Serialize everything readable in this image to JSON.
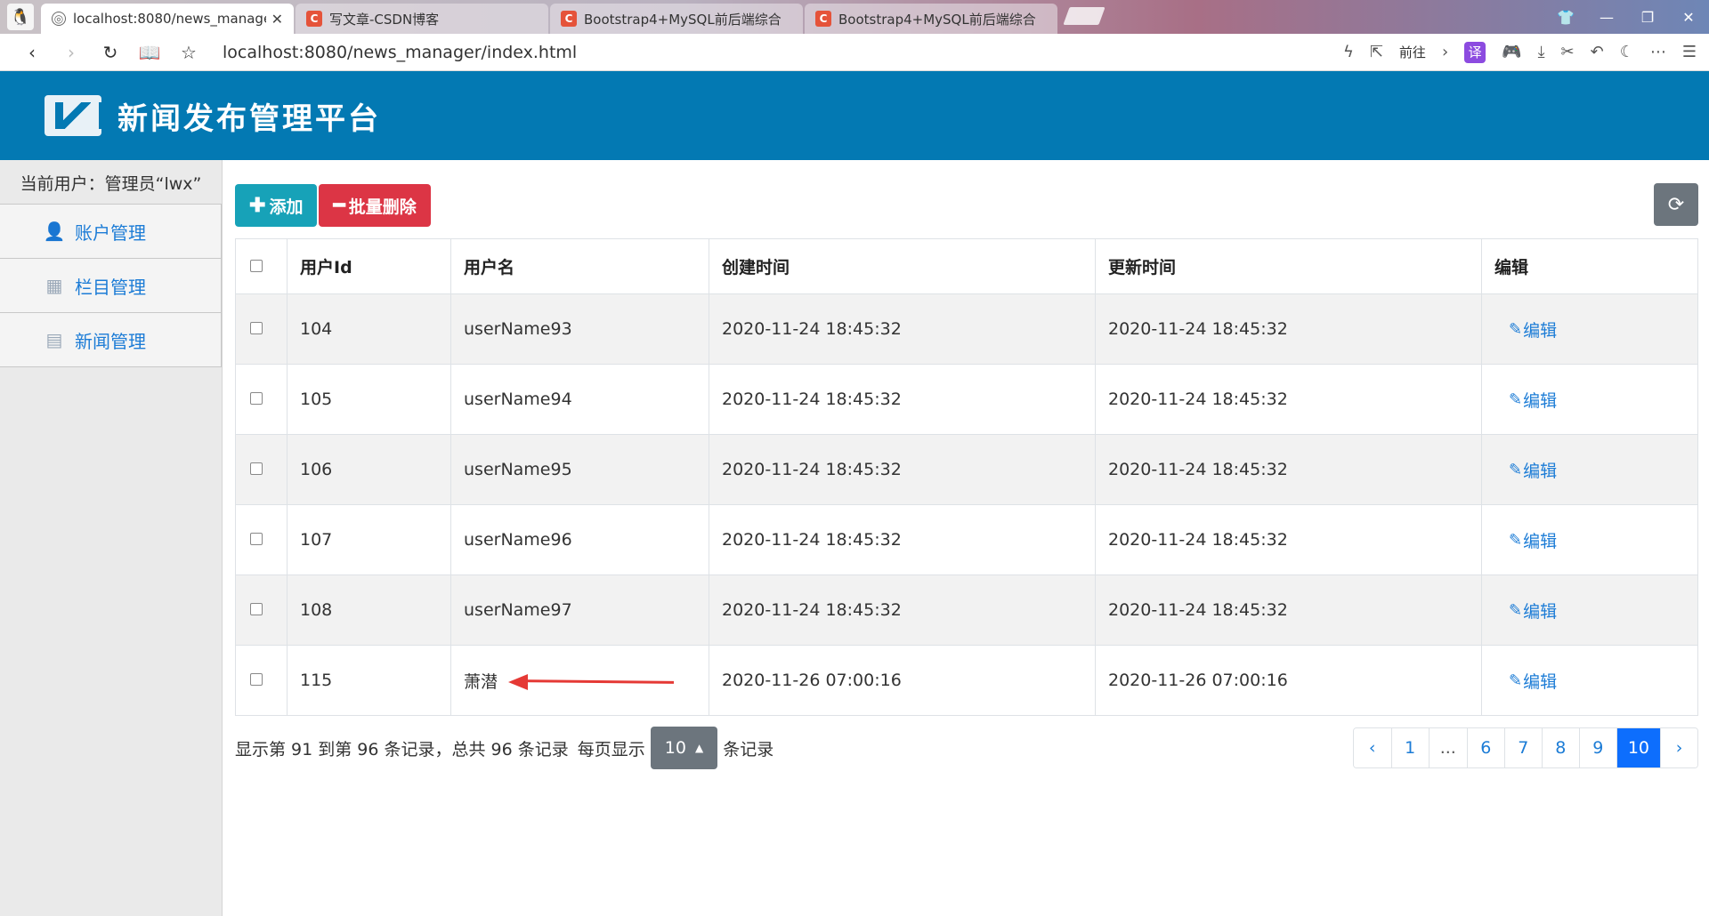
{
  "browser": {
    "tabs": [
      {
        "title": "localhost:8080/news_manage",
        "icon": "globe-icon",
        "active": true
      },
      {
        "title": "写文章-CSDN博客",
        "icon": "csdn-icon",
        "active": false
      },
      {
        "title": "Bootstrap4+MySQL前后端综合",
        "icon": "csdn-icon",
        "active": false
      },
      {
        "title": "Bootstrap4+MySQL前后端综合",
        "icon": "csdn-icon",
        "active": false
      }
    ],
    "url": "localhost:8080/news_manager/index.html",
    "goto_label": "前往",
    "translate_label": "译"
  },
  "app": {
    "title": "新闻发布管理平台",
    "header_color": "#0379b3"
  },
  "sidebar": {
    "current_user": "当前用户：管理员“lwx”",
    "items": [
      {
        "label": "账户管理",
        "icon": "user-icon"
      },
      {
        "label": "栏目管理",
        "icon": "grid-icon"
      },
      {
        "label": "新闻管理",
        "icon": "news-icon"
      }
    ]
  },
  "toolbar": {
    "add_label": "添加",
    "batch_delete_label": "批量删除"
  },
  "table": {
    "headers": [
      "用户Id",
      "用户名",
      "创建时间",
      "更新时间",
      "编辑"
    ],
    "edit_label": "编辑",
    "rows": [
      {
        "id": "104",
        "name": "userName93",
        "created": "2020-11-24 18:45:32",
        "updated": "2020-11-24 18:45:32"
      },
      {
        "id": "105",
        "name": "userName94",
        "created": "2020-11-24 18:45:32",
        "updated": "2020-11-24 18:45:32"
      },
      {
        "id": "106",
        "name": "userName95",
        "created": "2020-11-24 18:45:32",
        "updated": "2020-11-24 18:45:32"
      },
      {
        "id": "107",
        "name": "userName96",
        "created": "2020-11-24 18:45:32",
        "updated": "2020-11-24 18:45:32"
      },
      {
        "id": "108",
        "name": "userName97",
        "created": "2020-11-24 18:45:32",
        "updated": "2020-11-24 18:45:32"
      },
      {
        "id": "115",
        "name": "萧潜",
        "created": "2020-11-26 07:00:16",
        "updated": "2020-11-26 07:00:16"
      }
    ]
  },
  "footer": {
    "summary": "显示第 91 到第 96 条记录，总共 96 条记录",
    "per_page_prefix": "每页显示",
    "page_size": "10",
    "per_page_suffix": "条记录",
    "pages": [
      "‹",
      "1",
      "...",
      "6",
      "7",
      "8",
      "9",
      "10",
      "›"
    ],
    "active_page": "10"
  }
}
